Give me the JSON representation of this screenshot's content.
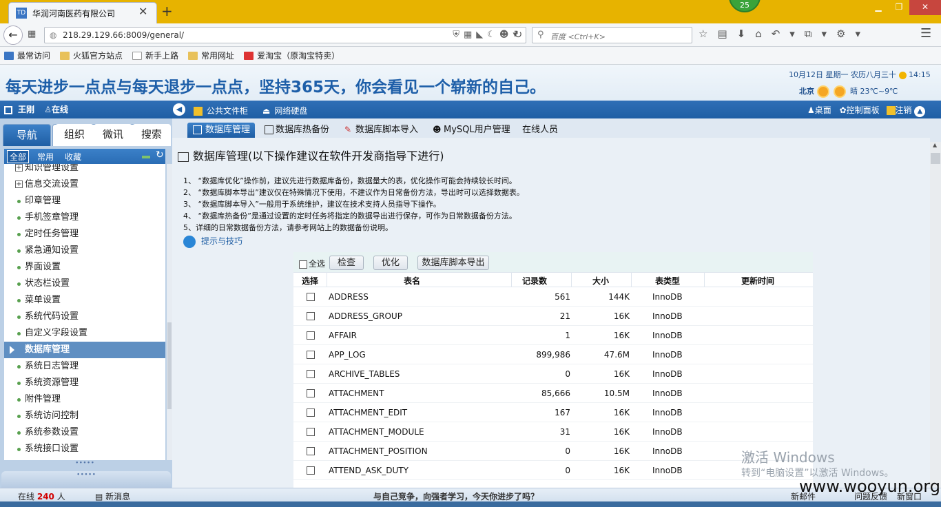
{
  "browser": {
    "tab_title": "华润河南医药有限公司",
    "tab_icon_text": "TD",
    "badge": "25",
    "url": "218.29.129.66:8009/general/",
    "search_placeholder": "百度 <Ctrl+K>"
  },
  "bookmarks": [
    "最常访问",
    "火狐官方站点",
    "新手上路",
    "常用网址",
    "爱淘宝（原淘宝特卖）"
  ],
  "banner": {
    "motto": "每天进步一点点与每天退步一点点，坚持365天，你会看见一个崭新的自己。",
    "date": "10月12日 星期一 农历八月三十",
    "time": "14:15",
    "city": "北京",
    "weather": "晴 23℃~9℃"
  },
  "appbar": {
    "user": "王刚",
    "status": "在线",
    "public_cabinet": "公共文件柜",
    "net_disk": "网络硬盘",
    "desktop": "桌面",
    "control_panel": "控制面板",
    "logout": "注销"
  },
  "left": {
    "tabs": [
      "导航",
      "组织",
      "微讯",
      "搜索"
    ],
    "subtabs": [
      "全部",
      "常用",
      "收藏"
    ],
    "menu": [
      {
        "label": "知识管理设置",
        "kind": "plus"
      },
      {
        "label": "信息交流设置",
        "kind": "plus"
      },
      {
        "label": "印章管理",
        "kind": "dot"
      },
      {
        "label": "手机签章管理",
        "kind": "dot"
      },
      {
        "label": "定时任务管理",
        "kind": "dot"
      },
      {
        "label": "紧急通知设置",
        "kind": "dot"
      },
      {
        "label": "界面设置",
        "kind": "dot"
      },
      {
        "label": "状态栏设置",
        "kind": "dot"
      },
      {
        "label": "菜单设置",
        "kind": "dot"
      },
      {
        "label": "系统代码设置",
        "kind": "dot"
      },
      {
        "label": "自定义字段设置",
        "kind": "dot"
      },
      {
        "label": "数据库管理",
        "kind": "active"
      },
      {
        "label": "系统日志管理",
        "kind": "dot"
      },
      {
        "label": "系统资源管理",
        "kind": "dot"
      },
      {
        "label": "附件管理",
        "kind": "dot"
      },
      {
        "label": "系统访问控制",
        "kind": "dot"
      },
      {
        "label": "系统参数设置",
        "kind": "dot"
      },
      {
        "label": "系统接口设置",
        "kind": "dot"
      }
    ]
  },
  "content_tabs": [
    "数据库管理",
    "数据库热备份",
    "数据库脚本导入",
    "MySQL用户管理",
    "在线人员"
  ],
  "page": {
    "title": "数据库管理(以下操作建议在软件开发商指导下进行)",
    "instructions": [
      "1、 “数据库优化”操作前，建议先进行数据库备份，数据量大的表，优化操作可能会持续较长时间。",
      "2、 “数据库脚本导出”建议仅在特殊情况下使用，不建议作为日常备份方法，导出时可以选择数据表。",
      "3、 “数据库脚本导入”一般用于系统维护，建议在技术支持人员指导下操作。",
      "4、 “数据库热备份”是通过设置的定时任务将指定的数据导出进行保存，可作为日常数据备份方法。",
      "5、详细的日常数据备份方法，请参考网站上的数据备份说明。"
    ],
    "tips": "提示与技巧"
  },
  "table": {
    "select_all": "全选",
    "buttons": {
      "check": "检查",
      "optimize": "优化",
      "export": "数据库脚本导出"
    },
    "headers": [
      "选择",
      "表名",
      "记录数",
      "大小",
      "表类型",
      "更新时间"
    ],
    "rows": [
      {
        "name": "ADDRESS",
        "records": "561",
        "size": "144K",
        "type": "InnoDB"
      },
      {
        "name": "ADDRESS_GROUP",
        "records": "21",
        "size": "16K",
        "type": "InnoDB"
      },
      {
        "name": "AFFAIR",
        "records": "1",
        "size": "16K",
        "type": "InnoDB"
      },
      {
        "name": "APP_LOG",
        "records": "899,986",
        "size": "47.6M",
        "type": "InnoDB"
      },
      {
        "name": "ARCHIVE_TABLES",
        "records": "0",
        "size": "16K",
        "type": "InnoDB"
      },
      {
        "name": "ATTACHMENT",
        "records": "85,666",
        "size": "10.5M",
        "type": "InnoDB"
      },
      {
        "name": "ATTACHMENT_EDIT",
        "records": "167",
        "size": "16K",
        "type": "InnoDB"
      },
      {
        "name": "ATTACHMENT_MODULE",
        "records": "31",
        "size": "16K",
        "type": "InnoDB"
      },
      {
        "name": "ATTACHMENT_POSITION",
        "records": "0",
        "size": "16K",
        "type": "InnoDB"
      },
      {
        "name": "ATTEND_ASK_DUTY",
        "records": "0",
        "size": "16K",
        "type": "InnoDB"
      }
    ]
  },
  "status": {
    "online_label": "在线",
    "online_count": "240",
    "online_unit": "人",
    "new_msg": "新消息",
    "slogan": "与自己竞争，向强者学习，今天你进步了吗？",
    "new_mail": "新邮件",
    "feedback": "问题反馈",
    "new_window": "新窗口"
  },
  "watermark": {
    "activate": "激活 Windows",
    "goto": "转到“电脑设置”以激活 Windows。",
    "site": "www.wooyun.org"
  }
}
